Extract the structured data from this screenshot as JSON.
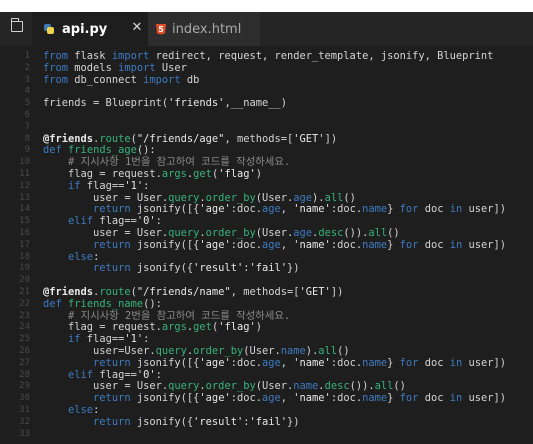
{
  "tabs": [
    {
      "label": "api.py",
      "icon": "python-icon",
      "active": true
    },
    {
      "label": "index.html",
      "icon": "html5-icon",
      "active": false
    }
  ],
  "colors": {
    "background": "#1e1e1e",
    "keyword": "#3d7bc0",
    "function": "#36b27a",
    "text": "#d4d4d4"
  },
  "code_lines": [
    {
      "num": "1",
      "text": "from flask import redirect, request, render_template, jsonify, Blueprint"
    },
    {
      "num": "2",
      "text": "from models import User"
    },
    {
      "num": "3",
      "text": "from db_connect import db"
    },
    {
      "num": "4",
      "text": ""
    },
    {
      "num": "5",
      "text": "friends = Blueprint('friends',__name__)"
    },
    {
      "num": "6",
      "text": ""
    },
    {
      "num": "7",
      "text": ""
    },
    {
      "num": "8",
      "text": "@friends.route(\"/friends/age\", methods=['GET'])"
    },
    {
      "num": "9",
      "text": "def friends_age():"
    },
    {
      "num": "10",
      "text": "    # 지시사항 1번을 참고하여 코드를 작성하세요."
    },
    {
      "num": "11",
      "text": "    flag = request.args.get('flag')"
    },
    {
      "num": "12",
      "text": "    if flag=='1':"
    },
    {
      "num": "13",
      "text": "        user = User.query.order_by(User.age).all()"
    },
    {
      "num": "14",
      "text": "        return jsonify([{'age':doc.age, 'name':doc.name} for doc in user])"
    },
    {
      "num": "15",
      "text": "    elif flag=='0':"
    },
    {
      "num": "16",
      "text": "        user = User.query.order_by(User.age.desc()).all()"
    },
    {
      "num": "17",
      "text": "        return jsonify([{'age':doc.age, 'name':doc.name} for doc in user])"
    },
    {
      "num": "18",
      "text": "    else:"
    },
    {
      "num": "19",
      "text": "        return jsonify({'result':'fail'})"
    },
    {
      "num": "20",
      "text": ""
    },
    {
      "num": "21",
      "text": "@friends.route(\"/friends/name\", methods=['GET'])"
    },
    {
      "num": "22",
      "text": "def friends_name():"
    },
    {
      "num": "23",
      "text": "    # 지시사항 2번을 참고하여 코드를 작성하세요."
    },
    {
      "num": "24",
      "text": "    flag = request.args.get('flag')"
    },
    {
      "num": "25",
      "text": "    if flag=='1':"
    },
    {
      "num": "26",
      "text": "        user=User.query.order_by(User.name).all()"
    },
    {
      "num": "27",
      "text": "        return jsonify([{'age':doc.age, 'name':doc.name} for doc in user])"
    },
    {
      "num": "28",
      "text": "    elif flag=='0':"
    },
    {
      "num": "29",
      "text": "        user = User.query.order_by(User.name.desc()).all()"
    },
    {
      "num": "30",
      "text": "        return jsonify([{'age':doc.age, 'name':doc.name} for doc in user])"
    },
    {
      "num": "31",
      "text": "    else:"
    },
    {
      "num": "32",
      "text": "        return jsonify({'result':'fail'})"
    },
    {
      "num": "33",
      "text": ""
    }
  ]
}
